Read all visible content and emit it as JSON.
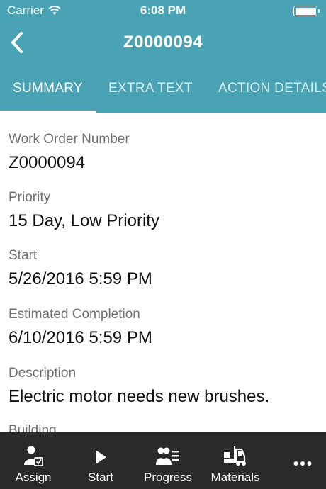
{
  "status_bar": {
    "carrier": "Carrier",
    "time": "6:08 PM"
  },
  "nav": {
    "title": "Z0000094"
  },
  "tabs": [
    {
      "label": "SUMMARY",
      "active": true
    },
    {
      "label": "EXTRA TEXT",
      "active": false
    },
    {
      "label": "ACTION DETAILS",
      "active": false
    }
  ],
  "fields": [
    {
      "label": "Work Order Number",
      "value": "Z0000094"
    },
    {
      "label": "Priority",
      "value": "15 Day, Low Priority"
    },
    {
      "label": "Start",
      "value": "5/26/2016 5:59 PM"
    },
    {
      "label": "Estimated Completion",
      "value": "6/10/2016 5:59 PM"
    },
    {
      "label": "Description",
      "value": "Electric motor needs new brushes."
    },
    {
      "label": "Building",
      "value": ""
    }
  ],
  "toolbar": {
    "assign": "Assign",
    "start": "Start",
    "progress": "Progress",
    "materials": "Materials",
    "more_icon": "more-horizontal-icon"
  },
  "colors": {
    "header": "#4aa3b5",
    "toolbar": "#2a2a2a"
  }
}
